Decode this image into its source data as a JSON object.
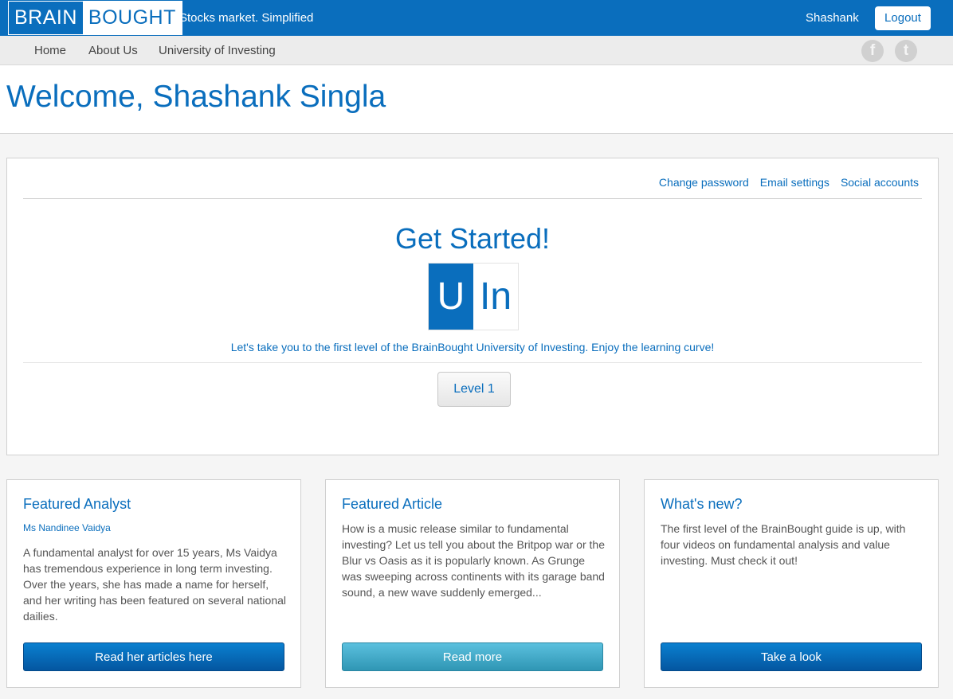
{
  "header": {
    "logo_part1": "BRAIN",
    "logo_part2": "BOUGHT",
    "tagline": "Stocks market. Simplified",
    "user_name": "Shashank",
    "logout_label": "Logout"
  },
  "nav": {
    "items": [
      {
        "label": "Home"
      },
      {
        "label": "About Us"
      },
      {
        "label": "University of Investing"
      }
    ],
    "social": [
      {
        "icon": "facebook-icon",
        "glyph": "f"
      },
      {
        "icon": "twitter-icon",
        "glyph": "t"
      }
    ]
  },
  "welcome": {
    "title": "Welcome, Shashank Singla"
  },
  "account_links": [
    {
      "label": "Change password"
    },
    {
      "label": "Email settings"
    },
    {
      "label": "Social accounts"
    }
  ],
  "get_started": {
    "title": "Get Started!",
    "logo_u": "U",
    "logo_in": "In",
    "intro": "Let's take you to the first level of the BrainBought University of Investing. Enjoy the learning curve!",
    "level_button": "Level 1"
  },
  "cards": [
    {
      "title": "Featured Analyst",
      "subtitle": "Ms Nandinee Vaidya",
      "body": "A fundamental analyst for over 15 years, Ms Vaidya has tremendous experience in long term investing. Over the years, she has made a name for herself, and her writing has been featured on several national dailies.",
      "button": "Read her articles here"
    },
    {
      "title": "Featured Article",
      "body": "How is a music release similar to fundamental investing? Let us tell you about the Britpop war or the Blur vs Oasis as it is popularly known. As Grunge was sweeping across continents with its garage band sound, a new wave suddenly emerged...",
      "button": "Read more"
    },
    {
      "title": "What's new?",
      "body": "The first level of the BrainBought guide is up, with four videos on fundamental analysis and value investing. Must check it out!",
      "button": "Take a look"
    }
  ],
  "colors": {
    "brand_blue": "#0a6ebd",
    "info_teal": "#5bc0de"
  }
}
